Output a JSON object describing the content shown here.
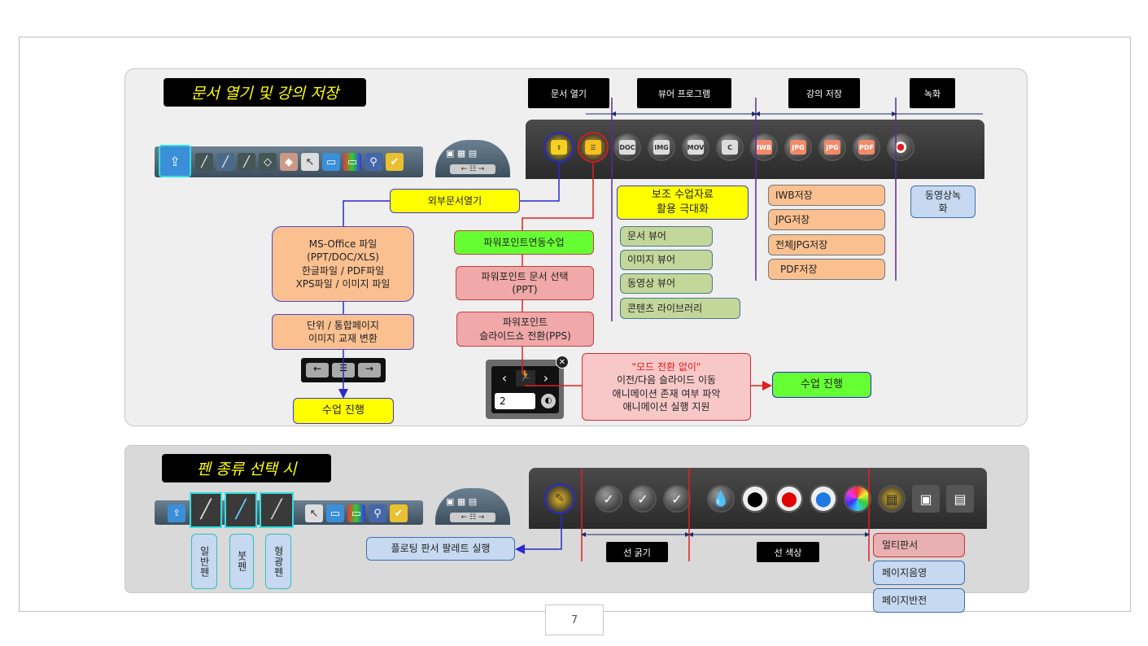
{
  "section1": {
    "title": "문서 열기 및 강의 저장",
    "headers": {
      "open": "문서 열기",
      "viewer": "뷰어 프로그램",
      "save": "강의 저장",
      "record": "녹화"
    },
    "toolbar_icons": [
      "DOC",
      "IMG",
      "MOV",
      "IWB",
      "JPG",
      "JPG",
      "PDF"
    ],
    "external_open": "외부문서열기",
    "ms_office": "MS-Office 파일\n(PPT/DOC/XLS)\n한글파일 / PDF파일\nXPS파일 / 이미지 파일",
    "convert": "단위 / 통합페이지\n이미지 교재 변환",
    "class_go_left": "수업 진행",
    "ppt_linked": "파워포인트연동수업",
    "ppt_select": "파워포인트 문서 선택\n(PPT)",
    "ppt_slideshow": "파워포인트\n슬라이드쇼 전환(PPS)",
    "mode_quote": "\"모드 전환 없이\"",
    "mode_desc": "이전/다음 슬라이드 이동\n애니메이션 존재 여부 파악\n애니메이션 실행 지원",
    "class_go_right": "수업 진행",
    "support": "보조 수업자료\n활용 극대화",
    "viewers": [
      "문서 뷰어",
      "이미지 뷰어",
      "동영상 뷰어",
      "콘텐츠 라이브러리"
    ],
    "saves": [
      "IWB저장",
      "JPG저장",
      "전체JPG저장",
      "PDF저장"
    ],
    "video_record": "동영상녹\n화",
    "slide_number": "2"
  },
  "section2": {
    "title": "펜 종류 선택 시",
    "pens": [
      "일반펜",
      "붓펜",
      "형광펜"
    ],
    "floating": "플로팅 판서 팔레트 실행",
    "thickness": "선 굵기",
    "color": "선 색상",
    "extras": [
      "멀티판서",
      "페이지음영",
      "페이지반전"
    ]
  },
  "colors": {
    "accent_yellow": "#ffff00",
    "accent_orange": "#fac090",
    "ink_drops": [
      "#ffffff",
      "#000000",
      "#e00000",
      "#1e7ae0",
      "rainbow"
    ]
  },
  "page_number": "7"
}
